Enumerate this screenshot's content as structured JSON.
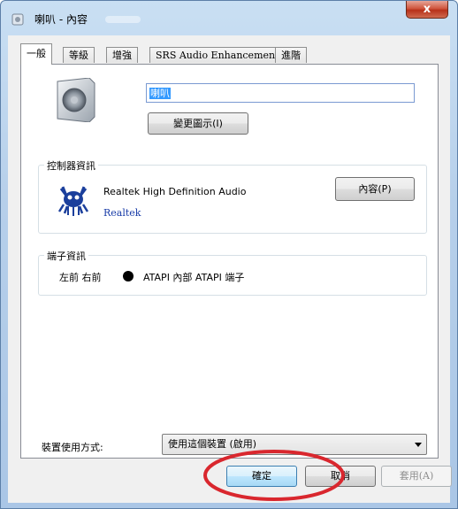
{
  "window": {
    "title": "喇叭 - 內容",
    "close_glyph": "x"
  },
  "tabs": [
    {
      "label": "一般",
      "active": true
    },
    {
      "label": "等級",
      "active": false
    },
    {
      "label": "增強",
      "active": false
    },
    {
      "label": "SRS Audio Enhancement",
      "active": false
    },
    {
      "label": "進階",
      "active": false
    }
  ],
  "device": {
    "name_value": "喇叭",
    "change_icon_label": "變更圖示(I)",
    "icon": "speaker-icon"
  },
  "controller": {
    "group_label": "控制器資訊",
    "name": "Realtek High Definition Audio",
    "vendor": "Realtek",
    "properties_label": "內容(P)",
    "icon": "realtek-crab-icon"
  },
  "port": {
    "group_label": "端子資訊",
    "position": "左前 右前",
    "name": "ATAPI 內部 ATAPI 端子",
    "jack_color": "#000000"
  },
  "usage": {
    "label": "裝置使用方式:",
    "selected": "使用這個裝置 (啟用)"
  },
  "buttons": {
    "ok": "確定",
    "cancel": "取消",
    "apply": "套用(A)"
  },
  "annotation": {
    "ellipse_color": "#d9272e"
  }
}
